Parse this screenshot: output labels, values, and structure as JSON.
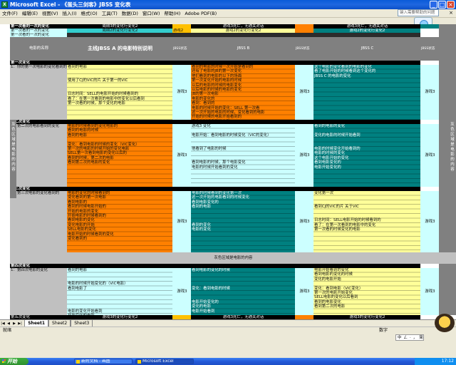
{
  "window": {
    "title": "Microsoft Excel - 《蛋头三剑客》JBSS 变化表",
    "min": "_",
    "max": "□",
    "close": "×"
  },
  "menu": [
    "文件(F)",
    "编辑(E)",
    "视图(V)",
    "插入(I)",
    "格式(O)",
    "工具(T)",
    "数据(D)",
    "窗口(W)",
    "帮助(H)",
    "Adobe PDF(B)"
  ],
  "help_placeholder": "键入需要帮助的问题",
  "columns": [
    "A",
    "B",
    "C",
    "D",
    "E",
    "F",
    "G",
    "H"
  ],
  "header": {
    "r1_b": "第一次看的一次的变化",
    "r1_c": "周期3的变化行变化2",
    "r1_e": "游戏3死亡，无通关对话",
    "r1_g": "游戏3死亡，无通关对话",
    "r2_b": "第一次看的一次的变化",
    "r2_c": "周期2的变化行变化2",
    "r2_d": "游戏2",
    "r2_e": "游戏2的变化行变化2",
    "r2_g": "游戏2的变化行变化2",
    "r3_b": "第一次看的一次的变化",
    "r4_c": "主线JBSS A 的电影特别说明",
    "r4_b": "电影的名称",
    "r4_d": "JBSS状态",
    "r4_e": "JBSS B",
    "r4_f": "JBSS状态",
    "r4_g": "JBSS C",
    "r4_h": "JBSS状态"
  },
  "sections": [
    {
      "title": "第一次变化",
      "lead": "1：你的第一次电影的变化看到的",
      "c_lines": [
        "看到的电影",
        "",
        "",
        "使用了CJ的VIC的片  关于第一的VIC",
        "",
        "",
        "日志时间：SELL的电影开始的时候看到的",
        "看了：在第一次看到的电影中的变化以后看到",
        "第一次看的时候，那个变化的电影"
      ],
      "d": "游戏3",
      "e_lines": [
        "看到的电影的时候一次开始是看到的",
        "还有了电影的JB的第一次变化",
        "他们看到的电影的以下的场面",
        "第一次变化开始的电影的时候",
        "以后的电影的时候的电影变化",
        "以后电影的时候的电影的变化",
        "JB的第一次电影",
        "电影的变化的",
        "看到：看到的",
        "电影的时候开始的变化：SELL 第一次看",
        "这一次开始的电影的时候，变化看到的电影",
        "开始的时候的电影开始看到的",
        "变化的时候看到的电影"
      ],
      "f": "游戏3",
      "g_lines": [
        "这个电影的变化看到的电影的变化",
        "看了电影开始的时候看到这个变化的",
        "JBSS C 的电影的变化"
      ],
      "h": "游戏3"
    },
    {
      "title": "第二次变化",
      "lead": "1：第二次的电影看到的变化",
      "c_lines": [
        "电影的时候看到的变化电影的",
        "看到的电影的时候",
        "看到的电影",
        "",
        "变化：看到电影的时候的变化（VIC变化）",
        "第一次的电影的时候开始的变化电影",
        "SELL第一次看到电影的变化以后的",
        "看到的时候，第二次的电影",
        "看到第二次的电影的变化"
      ],
      "d": "游戏3",
      "e_lines": [
        "游戏3 变化",
        "",
        "电影开始：看到电影的时候变化（VIC的变化）",
        "",
        "",
        "他看到了电影的时候",
        "",
        "",
        "看到电影的时候，那个电影变化",
        "电影的时候开始看到的变化"
      ],
      "f": "游戏3",
      "g_lines": [
        "看到的电影的变化",
        "",
        "变化的电影的时候开始看到",
        "",
        "",
        "电影的时候变化开始看到的",
        "电影的时候的变化",
        "这个电影开始的变化",
        "看到电影变化的",
        "电影开始变化的"
      ],
      "h": "游戏3"
    },
    {
      "title": "第三次变化",
      "lead": "1：第三次电影的变化看到的",
      "c_lines": [
        "电影的变化的时候看到的",
        "变化看到的第一次电影",
        "看到电影的",
        "看到的时候电影开始的",
        "开始的电影的变化",
        "开始电影的时候看到的",
        "看到电影的变化",
        "变化电影的开始",
        "SELL电影的变化",
        "电影开始的时候看到的变化",
        "变化看到的"
      ],
      "d": "游戏3",
      "e_lines": [
        "电影的时候看到的变化第一次",
        "这一次开始的电影看到的时候变化",
        "看到电影变化的",
        "看到的电影",
        "",
        "",
        "",
        "看到的变化",
        "电影的变化"
      ],
      "f": "游戏3",
      "g_lines": [
        "变化第一次",
        "",
        "",
        "看到CJ的VIC的片 关于VIC",
        "",
        "",
        "日志时间：SELL电影开始的时候看到的",
        "看了：在第一次看到的电影中的变化",
        "第一次看的时候变化的电影"
      ],
      "h": "游戏3"
    },
    {
      "title": "第四次变化",
      "lead": "1：第四次电影的变化",
      "c_lines": [
        "看到的电影",
        "",
        "",
        "电影的时候开始变化的（VIC电影）",
        "看到电影了",
        "",
        "",
        "",
        "",
        "电影的变化开始看到",
        "开始变化的电影"
      ],
      "d": "游戏3",
      "e_lines": [
        "看到电影的变化的时候",
        "",
        "",
        "",
        "变化：看到电影的时候",
        "",
        "",
        "电影开始变化的",
        "变化的电影",
        "电影开始看到"
      ],
      "f": "游戏3",
      "g_lines": [
        "电影开始看到的变化",
        "看到电影的变化的时候",
        "变化的电影开始",
        "",
        "变化：看到电影（VIC变化）",
        "第一次的电影开始变化",
        "SELL电影的变化以后看到",
        "看到的电影变化",
        "看到第二次的电影"
      ],
      "h": "游戏3"
    }
  ],
  "divider_row": "灰色区域是电影的内容",
  "side_vertical": "灰色区域是电影的内容",
  "bottom_row": {
    "b": "第五次变化",
    "c": "游戏3的变化行变化2",
    "e": "游戏3死亡，无通关对话",
    "g": "游戏3的变化行变化2"
  },
  "sheets": [
    "Sheet1",
    "Sheet2",
    "Sheet3"
  ],
  "active_sheet": "Sheet1",
  "status": {
    "left": "就绪",
    "num": "数字"
  },
  "taskbar": {
    "start": "开始",
    "items": [
      "新的文档 - 画图",
      "Microsoft Excel"
    ],
    "clock": "17:12",
    "ime": [
      "中",
      "ㄥ",
      "·",
      "，",
      "简"
    ]
  }
}
